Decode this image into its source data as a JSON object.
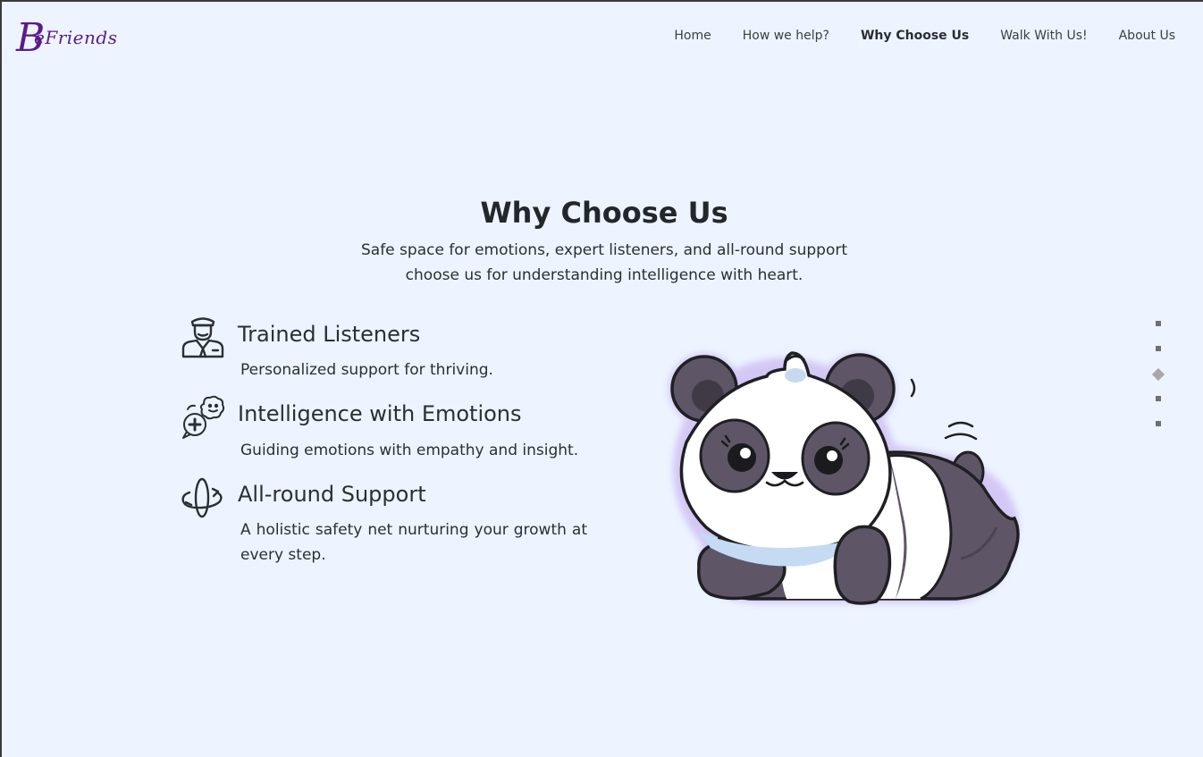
{
  "header": {
    "logo_initial": "B",
    "logo_rest": "eFriends",
    "nav": [
      {
        "label": "Home",
        "active": false
      },
      {
        "label": "How we help?",
        "active": false
      },
      {
        "label": "Why Choose Us",
        "active": true
      },
      {
        "label": "Walk With Us!",
        "active": false
      },
      {
        "label": "About Us",
        "active": false
      }
    ]
  },
  "section": {
    "title": "Why Choose Us",
    "subtitle_line1": "Safe space for emotions, expert listeners, and all-round support",
    "subtitle_line2": "choose us for understanding intelligence with heart."
  },
  "features": [
    {
      "title": "Trained Listeners",
      "desc": "Personalized support for thriving.",
      "icon": "listener-icon"
    },
    {
      "title": "Intelligence with Emotions",
      "desc": "Guiding emotions with empathy and insight.",
      "icon": "emotions-chat-icon"
    },
    {
      "title": "All-round Support",
      "desc": "A holistic safety net nurturing your growth at every step.",
      "icon": "orbit-support-icon"
    }
  ],
  "illustration": "panda-illustration",
  "pagination": {
    "count": 5,
    "active_index": 2
  },
  "colors": {
    "background": "#edf4ff",
    "logo": "#5a1c8a",
    "text": "#23272b",
    "panda_dark": "#5e5666",
    "panda_glow": "#cdbdf3"
  }
}
